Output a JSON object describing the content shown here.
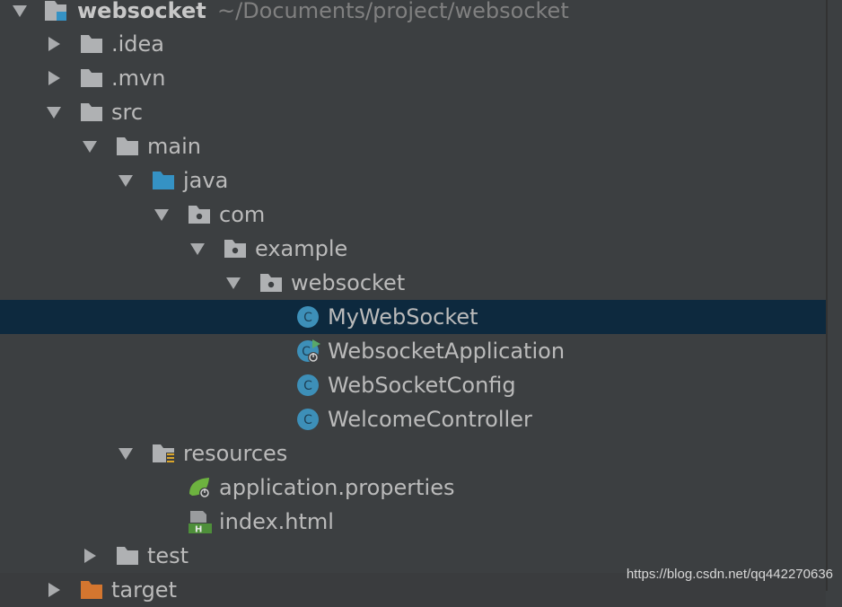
{
  "project": {
    "name": "websocket",
    "path": "~/Documents/project/websocket"
  },
  "tree": {
    "idea": ".idea",
    "mvn": ".mvn",
    "src": "src",
    "main": "main",
    "java": "java",
    "com": "com",
    "example": "example",
    "websocket_pkg": "websocket",
    "class_mywebsocket": "MyWebSocket",
    "class_websocketapplication": "WebsocketApplication",
    "class_websocketconfig": "WebSocketConfig",
    "class_welcomecontroller": "WelcomeController",
    "resources": "resources",
    "application_properties": "application.properties",
    "index_html": "index.html",
    "test": "test",
    "target": "target"
  },
  "watermark": "https://blog.csdn.net/qq442270636",
  "colors": {
    "background": "#3c3f41",
    "selection": "#0d293e",
    "folder": "#afb1b3",
    "source_folder": "#3592c4",
    "class_icon": "#3d8fb8",
    "spring": "#6db33f",
    "target_folder": "#d4762f"
  }
}
